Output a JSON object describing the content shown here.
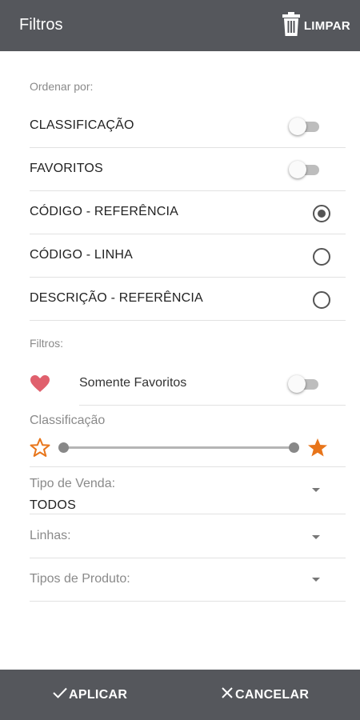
{
  "header": {
    "title": "Filtros",
    "clear_label": "LIMPAR",
    "clear_icon": "trash-icon"
  },
  "sort": {
    "section_label": "Ordenar por:",
    "toggles": [
      {
        "label": "CLASSIFICAÇÃO",
        "on": false
      },
      {
        "label": "FAVORITOS",
        "on": false
      }
    ],
    "options": [
      {
        "label": "CÓDIGO - REFERÊNCIA",
        "selected": true
      },
      {
        "label": "CÓDIGO - LINHA",
        "selected": false
      },
      {
        "label": "DESCRIÇÃO - REFERÊNCIA",
        "selected": false
      }
    ]
  },
  "filters": {
    "section_label": "Filtros:",
    "favorites_only": {
      "label": "Somente Favoritos",
      "on": false,
      "icon": "heart-icon"
    },
    "rating": {
      "label": "Classificação",
      "min_icon": "star-outline-icon",
      "max_icon": "star-filled-icon"
    },
    "sale_type": {
      "label": "Tipo de Venda:",
      "value": "TODOS"
    },
    "lines": {
      "label": "Linhas:",
      "value": ""
    },
    "product_types": {
      "label": "Tipos de Produto:",
      "value": ""
    }
  },
  "footer": {
    "apply_label": "APLICAR",
    "cancel_label": "CANCELAR"
  },
  "colors": {
    "bar": "#55575c",
    "heart": "#e0606d",
    "star": "#e8751a",
    "text": "#222222",
    "muted": "#8a8a8a"
  }
}
